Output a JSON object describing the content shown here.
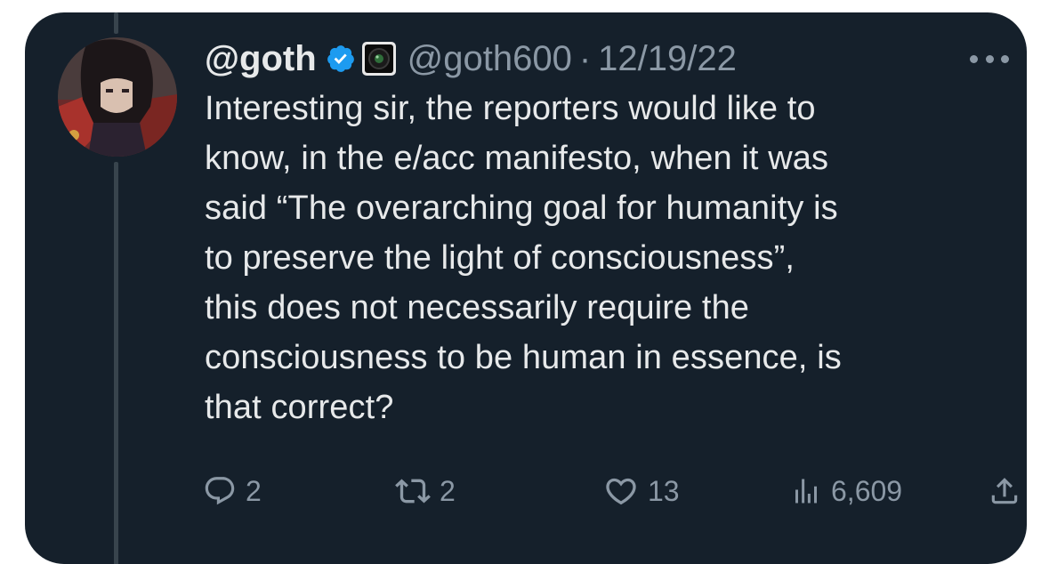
{
  "tweet": {
    "display_name": "@goth",
    "handle": "@goth600",
    "separator": "·",
    "date": "12/19/22",
    "text_lines": [
      "Interesting sir, the reporters would like to",
      "know, in the e/acc manifesto, when it was",
      "said “The overarching goal for humanity is",
      "to preserve the light of consciousness”,",
      "this does not necessarily require the",
      "consciousness to be human in essence, is",
      "that correct?"
    ]
  },
  "actions": {
    "replies": "2",
    "retweets": "2",
    "likes": "13",
    "views": "6,609"
  },
  "icons": {
    "verified": "verified-badge-icon",
    "affiliate": "affiliate-badge-icon",
    "more": "more-options-icon",
    "reply": "reply-icon",
    "retweet": "retweet-icon",
    "like": "heart-icon",
    "views": "views-icon",
    "share": "share-icon"
  },
  "colors": {
    "background": "#15202b",
    "primary_text": "#e7e9ea",
    "secondary_text": "#8b98a5",
    "verified_blue": "#1d9bf0",
    "thread_line": "#38444d"
  }
}
